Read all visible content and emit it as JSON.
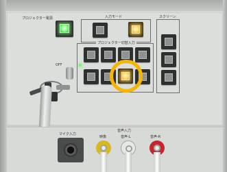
{
  "scene": {
    "type": "photo",
    "subject": "projector control wall panel"
  },
  "labels": {
    "projector_power": "プロジェクター電源",
    "input_mode": "入力モード",
    "projector_input_select": "プロジェクター切替入力",
    "screen": "スクリーン",
    "key_off": "OFF",
    "audio_input": "音声入力",
    "video": "映像",
    "audio_l": "音声-L",
    "audio_r": "音声-R",
    "mic_input": "マイク入力"
  },
  "colors": {
    "highlight_ring": "#f5b500",
    "lit_button": "#ffe27a",
    "power_led": "#6bff63"
  },
  "highlight": {
    "target": "lit-input-button"
  }
}
